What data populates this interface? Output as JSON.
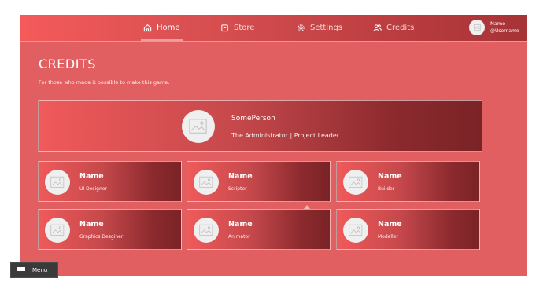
{
  "nav": {
    "items": [
      {
        "label": "Home",
        "icon": "home-icon",
        "active": true
      },
      {
        "label": "Store",
        "icon": "bag-icon",
        "active": false
      },
      {
        "label": "Settings",
        "icon": "gear-icon",
        "active": false
      },
      {
        "label": "Credits",
        "icon": "users-icon",
        "active": false
      }
    ],
    "user": {
      "name": "Name",
      "handle": "@Username",
      "icon": "image-placeholder-icon"
    }
  },
  "page": {
    "title": "CREDITS",
    "subtitle": "For those who made it possible to make this game."
  },
  "lead": {
    "name": "SomePerson",
    "role": "The Administrator | Project Leader"
  },
  "credits": [
    {
      "name": "Name",
      "role": "UI Designer"
    },
    {
      "name": "Name",
      "role": "Scripter"
    },
    {
      "name": "Name",
      "role": "Builder"
    },
    {
      "name": "Name",
      "role": "Graphics Desginer"
    },
    {
      "name": "Name",
      "role": "Animator"
    },
    {
      "name": "Name",
      "role": "Modeller"
    }
  ],
  "menu": {
    "label": "Menu",
    "icon": "hamburger-icon"
  },
  "colors": {
    "background": "#e15f60",
    "card_start": "#f05a5b",
    "card_end": "#7a2326",
    "menu_bg": "#3a3a3a"
  }
}
